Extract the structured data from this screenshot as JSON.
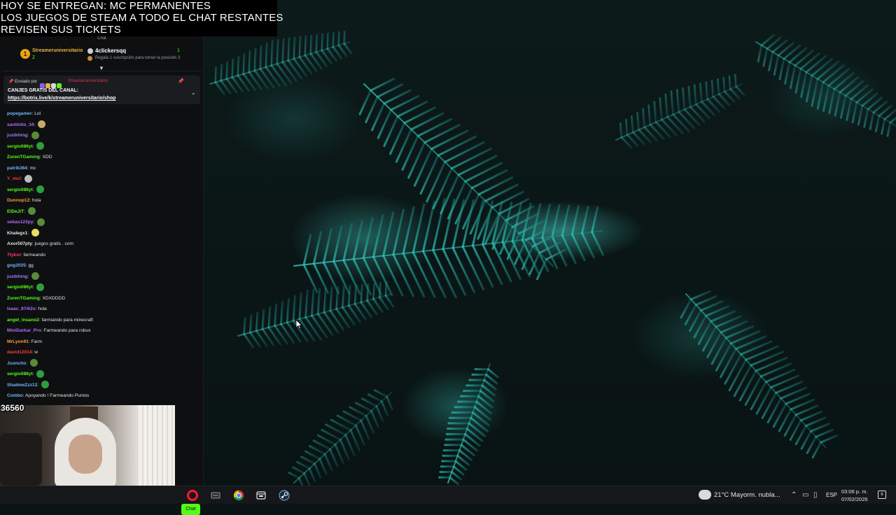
{
  "overlay": {
    "lines": [
      "HOY SE ENTREGAN: MC PERMANENTES",
      "LOS JUEGOS DE STEAM A TODO EL CHAT RESTANTES",
      "REVISEN SUS TICKETS"
    ]
  },
  "chat": {
    "heading": "Chat",
    "leaderboard": {
      "rank": "1",
      "top_name": "Streameruniversitario",
      "top_count": "2",
      "gifter": "4clickersqq",
      "gifter_count": "1",
      "hint": "Regala 1 suscripción para tomar la posición 3"
    },
    "pinned": {
      "sent_by": "Enviado por",
      "author": "Streameruniversitario",
      "title": "CANJES GRATIS DEL CANAL:",
      "link": "https://botrix.live/k/streameruniversitario/shop"
    },
    "messages": [
      {
        "user": "popegamer",
        "text": "Lol",
        "color": "#6fb6ff",
        "emote": ""
      },
      {
        "user": "santinito_34",
        "text": "",
        "color": "#b36bff",
        "emote": "#c8a86a"
      },
      {
        "user": "justkhing",
        "text": "",
        "color": "#9b7bff",
        "emote": "#5a8a3a"
      },
      {
        "user": "sergio086yt",
        "text": "",
        "color": "#53fc18",
        "emote": "#2e9e3e"
      },
      {
        "user": "ZurenTGaming",
        "text": "XDD",
        "color": "#53fc18",
        "emote": ""
      },
      {
        "user": "patrik364",
        "text": "mc",
        "color": "#6fb6ff",
        "emote": ""
      },
      {
        "user": "Y_mcl",
        "text": "",
        "color": "#ff3b3b",
        "emote": "#bdbdbd"
      },
      {
        "user": "sergio086yt",
        "text": "",
        "color": "#53fc18",
        "emote": "#2e9e3e"
      },
      {
        "user": "Dunnop12",
        "text": "hola",
        "color": "#ff9b3a",
        "emote": ""
      },
      {
        "user": "ElDeJiT",
        "text": "",
        "color": "#53fc18",
        "emote": "#5a8a3a"
      },
      {
        "user": "sebas123py",
        "text": "",
        "color": "#b36bff",
        "emote": "#5a8a3a"
      },
      {
        "user": "Khalegx1",
        "text": "",
        "color": "#e6e6e6",
        "emote": "#e8e060"
      },
      {
        "user": "Axor507pty",
        "text": "juegos gratis . com",
        "color": "#e6e6e6",
        "emote": ""
      },
      {
        "user": "7tykor",
        "text": "farmeando",
        "color": "#ff3b6b",
        "emote": ""
      },
      {
        "user": "gog2025",
        "text": "gg",
        "color": "#6fb6ff",
        "emote": ""
      },
      {
        "user": "justkhing",
        "text": "",
        "color": "#9b7bff",
        "emote": "#5a8a3a"
      },
      {
        "user": "sergio086yt",
        "text": "",
        "color": "#53fc18",
        "emote": "#2e9e3e"
      },
      {
        "user": "ZurenTGaming",
        "text": "XDXDDDD",
        "color": "#53fc18",
        "emote": ""
      },
      {
        "user": "Isaac_874i2o",
        "text": "hola",
        "color": "#b36bff",
        "emote": ""
      },
      {
        "user": "angel_insano2",
        "text": "farmiando para minecraft",
        "color": "#53fc18",
        "emote": ""
      },
      {
        "user": "MiniDarkar_Pro",
        "text": "Farmeando para robux",
        "color": "#b36bff",
        "emote": ""
      },
      {
        "user": "MrLyon91",
        "text": "Farm",
        "color": "#ff9b3a",
        "emote": ""
      },
      {
        "user": "david12014",
        "text": "w",
        "color": "#ff3b3b",
        "emote": ""
      },
      {
        "user": "Juxncito",
        "text": "",
        "color": "#6fb6ff",
        "emote": "#5a8a3a"
      },
      {
        "user": "sergio086yt",
        "text": "",
        "color": "#53fc18",
        "emote": "#2e9e3e"
      },
      {
        "user": "ShadowZzz12",
        "text": "",
        "color": "#6fb6ff",
        "emote": "#2e9e3e"
      },
      {
        "user": "Combo",
        "text": "Apoyando ! Farmeando Puntos",
        "color": "#6fb6ff",
        "emote": ""
      }
    ],
    "chat_button": "Chat"
  },
  "webcam": {
    "viewer_count": "36560"
  },
  "taskbar": {
    "apps": [
      "opera-icon",
      "icue-icon",
      "chrome-icon",
      "file-manager-icon",
      "steam-icon"
    ],
    "weather": "21°C  Mayorm. nubla...",
    "language": "ESP",
    "time": "03:06 p. m.",
    "date": "07/02/2026",
    "notifications": "6"
  }
}
